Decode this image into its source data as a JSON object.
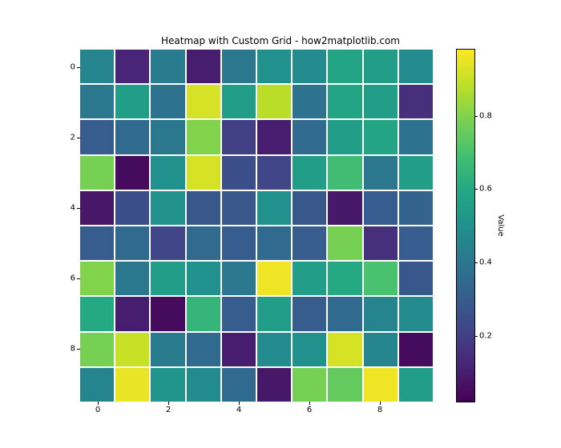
{
  "chart_data": {
    "type": "heatmap",
    "title": "Heatmap with Custom Grid - how2matplotlib.com",
    "xlabel": "",
    "ylabel": "",
    "x_ticks": [
      0,
      2,
      4,
      6,
      8
    ],
    "y_ticks": [
      0,
      2,
      4,
      6,
      8
    ],
    "colorbar_label": "Value",
    "colorbar_ticks": [
      0.2,
      0.4,
      0.6,
      0.8
    ],
    "vmin": 0.02,
    "vmax": 0.98,
    "colormap": "viridis",
    "data": [
      [
        0.45,
        0.12,
        0.42,
        0.1,
        0.4,
        0.5,
        0.48,
        0.58,
        0.55,
        0.48
      ],
      [
        0.4,
        0.55,
        0.38,
        0.92,
        0.55,
        0.88,
        0.38,
        0.58,
        0.55,
        0.15
      ],
      [
        0.3,
        0.35,
        0.4,
        0.8,
        0.2,
        0.1,
        0.35,
        0.55,
        0.58,
        0.38
      ],
      [
        0.78,
        0.05,
        0.5,
        0.92,
        0.25,
        0.22,
        0.55,
        0.68,
        0.4,
        0.55
      ],
      [
        0.08,
        0.25,
        0.5,
        0.28,
        0.28,
        0.5,
        0.28,
        0.08,
        0.3,
        0.32
      ],
      [
        0.3,
        0.35,
        0.22,
        0.35,
        0.3,
        0.35,
        0.3,
        0.78,
        0.15,
        0.3
      ],
      [
        0.8,
        0.4,
        0.55,
        0.5,
        0.4,
        0.96,
        0.55,
        0.6,
        0.7,
        0.28
      ],
      [
        0.6,
        0.1,
        0.05,
        0.65,
        0.3,
        0.55,
        0.3,
        0.35,
        0.45,
        0.48
      ],
      [
        0.78,
        0.9,
        0.42,
        0.35,
        0.1,
        0.48,
        0.5,
        0.92,
        0.45,
        0.05
      ],
      [
        0.45,
        0.95,
        0.52,
        0.48,
        0.35,
        0.08,
        0.78,
        0.75,
        0.96,
        0.55
      ]
    ]
  }
}
